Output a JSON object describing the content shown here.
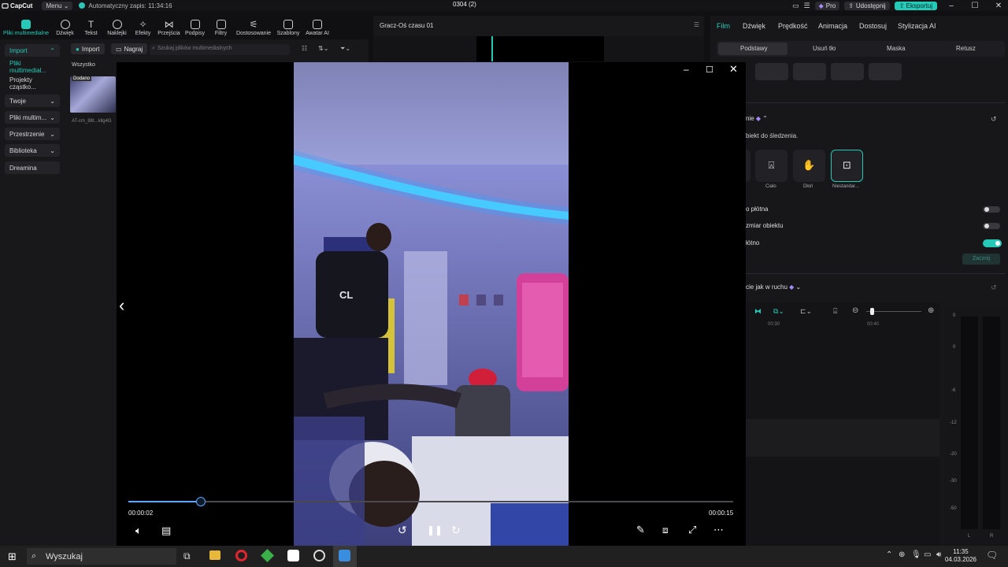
{
  "app": {
    "logo": "CapCut",
    "menu_label": "Menu",
    "autosave": "Automatyczny zapis: 11:34:16",
    "project_title": "0304 (2)",
    "pro_label": "Pro",
    "share_label": "Udostępnij",
    "export_label": "Eksportuj"
  },
  "toolbar": {
    "items": [
      "Pliki multimedialne",
      "Dźwięk",
      "Tekst",
      "Naklejki",
      "Efekty",
      "Przejścia",
      "Podpisy",
      "Filtry",
      "Dostosowanie",
      "Szablony",
      "Awatar AI"
    ]
  },
  "left": {
    "sidebar": [
      "Import",
      "Pliki multimedial...",
      "Projekty cząstko...",
      "Twoje",
      "Pliki multim...",
      "Przestrzenie",
      "Biblioteka",
      "Dreamina"
    ],
    "import_btn": "Import",
    "record_btn": "Nagraj",
    "search_placeholder": "Szukaj plików multimedialnych",
    "filter_all": "Wszystko",
    "thumb_badge": "Dodano",
    "thumb_name": "AT-cm_88t...kllg4G"
  },
  "player": {
    "title": "Gracz-Oś czasu 01"
  },
  "right": {
    "tabs": [
      "Film",
      "Dźwięk",
      "Prędkość",
      "Animacja",
      "Dostosuj",
      "Stylizacja AI"
    ],
    "subtabs": [
      "Podstawy",
      "Usuń tło",
      "Maska",
      "Retusz"
    ],
    "section1": "nie",
    "section1_desc": "biekt do śledzenia.",
    "track_options": [
      "Ciało",
      "Dłoń",
      "Niestandar..."
    ],
    "toggle1": "o płótna",
    "toggle2": "zmiar obiektu",
    "toggle3": "łótno",
    "start_btn": "Zacznij",
    "section2": "cie jak w ruchu",
    "ruler_a": "00:30",
    "ruler_b": "00:40",
    "meter_ticks": [
      "0",
      "-6",
      "-12",
      "-20",
      "-30",
      "-50"
    ],
    "meter_lr": [
      "L",
      "R"
    ]
  },
  "viewer": {
    "current_time": "00:00:02",
    "total_time": "00:00:15",
    "progress": 0.12
  },
  "taskbar": {
    "search": "Wyszukaj",
    "time": "11:35",
    "date": "04.03.2026"
  },
  "colors": {
    "accent": "#25c9b8",
    "progress": "#5aa8ff"
  }
}
